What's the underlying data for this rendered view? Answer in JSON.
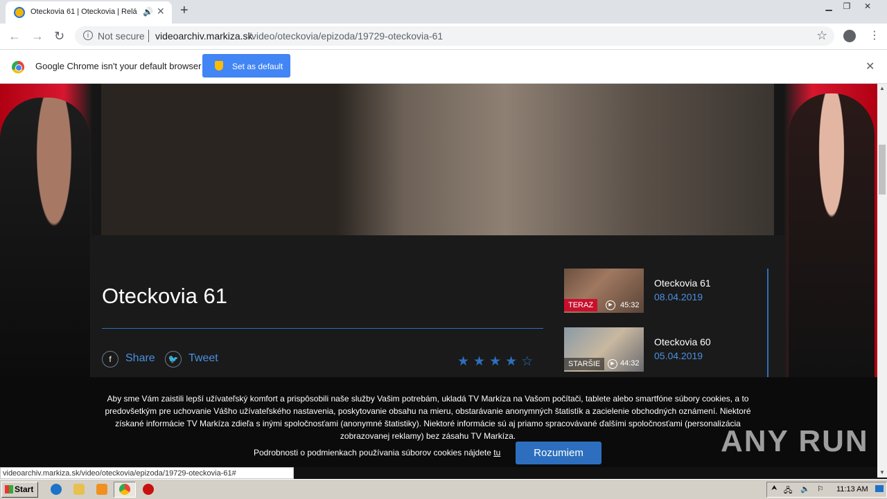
{
  "browser": {
    "tab_title": "Oteckovia 61 | Oteckovia | Relá",
    "url_security": "Not secure",
    "url_host": "videoarchiv.markiza.sk",
    "url_path": "/video/oteckovia/epizoda/19729-oteckovia-61",
    "infobar_text": "Google Chrome isn't your default browser",
    "infobar_button": "Set as default",
    "status_url": "videoarchiv.markiza.sk/video/oteckovia/epizoda/19729-oteckovia-61#"
  },
  "episode": {
    "title": "Oteckovia 61",
    "share_label": "Share",
    "tweet_label": "Tweet",
    "rating": 4,
    "rating_max": 5
  },
  "related": [
    {
      "title": "Oteckovia 61",
      "date": "08.04.2019",
      "badge": "TERAZ",
      "duration": "45:32"
    },
    {
      "title": "Oteckovia 60",
      "date": "05.04.2019",
      "badge": "STARŠIE",
      "duration": "44:32"
    }
  ],
  "cookie": {
    "text": "Aby sme Vám zaistili lepší užívateľský komfort a prispôsobili naše služby Vašim potrebám, ukladá TV Markíza na Vašom počítači, tablete alebo smartfóne súbory cookies, a to predovšetkým pre uchovanie Vášho užívateľského nastavenia, poskytovanie obsahu na mieru, obstarávanie anonymných štatistík a zacielenie obchodných oznámení. Niektoré získané informácie TV Markíza zdieľa s inými spoločnosťami (anonymné štatistiky). Niektoré informácie sú aj priamo spracovávané ďalšími spoločnosťami (personalizácia zobrazovanej reklamy) bez zásahu TV Markíza.",
    "link_prefix": "Podrobnosti o podmienkach používania súborov cookies nájdete",
    "link_text": "tu",
    "accept": "Rozumiem"
  },
  "watermark": "ANY RUN",
  "taskbar": {
    "start": "Start",
    "clock": "11:13 AM"
  }
}
